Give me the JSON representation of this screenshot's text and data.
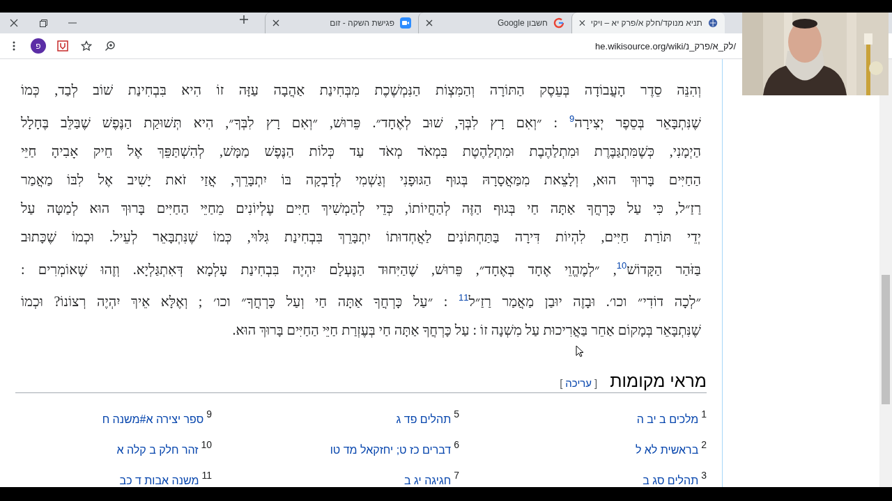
{
  "tabs": [
    {
      "title": "תניא מנוקד/חלק א/פרק יא – ויקי",
      "kind": "globe",
      "selected": true
    },
    {
      "title": "חשבון Google",
      "kind": "letter",
      "selected": false
    },
    {
      "title": "פגישת השקה - זום",
      "kind": "video",
      "selected": false
    }
  ],
  "toolbar": {
    "url": "he.wikisource.org/wiki/לק_א/פרק_נ/",
    "profile_initial": "פ"
  },
  "article": {
    "lines": [
      "וְהִנֵּה סֵדֶר הָעֲבוֹדָה בְּעֵסֶק הַתּוֹרָה וְהַמִּצְוֹת הַנִּמְשֶׁכֶת מִבְּחִינַת אַהֲבָה עַזָּה זוֹ הִיא בִּבְחִינַת שׁוֹב לְבַד, כְּמוֹ",
      "שֶׁנִּתְבָּאֵר בְּסֵפֶר יְצִירָה$^{9}$ : ״וְאִם רָץ לִבְּךָ, שׁוּב לְאֶחָד״. פֵּרוּשׁ, ״וְאִם רָץ לִבְּךָ״, הִיא תְּשׁוּקַת הַנֶּפֶשׁ שֶׁבַּלֵּב בֶּחָלָל",
      "הַיְמָנִי, כְּשֶׁמִּתְגַּבֶּרֶת וּמִתְלַהֶבֶת וּמִתְלַהֶטֶת בִּמְאֹד מְאֹד עַד כְּלוֹת הַנֶּפֶשׁ מַמָּשׁ, לְהִשְׁתַּפֵּךְ אֶל חֵיק אָבִיהָ חַיֵּי",
      "הַחַיִּים בָּרוּךְ הוּא, וְלָצֵאת מִמַּאֲסָרָהּ בְּגוּף הַגּוּפָנִי וְגַשְׁמִי לְדָבְקָה בּוֹ יִתְבָּרֵךְ, אֲזַי זֹאת יָשִׁיב אֶל לִבּוֹ מַאֲמַר",
      "רַזַ״ל, כִּי עַל כָּרְחֲךָ אַתָּה חַי בְּגוּף הַזֶּה לְהַחֲיוֹתוֹ, כְּדֵי לְהַמְשִׁיךְ חַיִּים עֶלְיוֹנִים מֵחַיֵּי הַחַיִּים בָּרוּךְ הוּא לְמַטָּה עַל",
      "יְדֵי תּוֹרַת חַיִּים, לִהְיוֹת דִּירָה בַּתַּחְתּוֹנִים לַאֲחְדוּתוֹ יִתְבָּרֵךְ בִּבְחִינַת גִּלּוּי, כְּמוֹ שֶׁנִּתְבָּאֵר לְעֵיל. וּכְמוֹ שֶׁכָּתוּב",
      "בַּזֹּהַר הַקָּדוֹשׁ$^{10}$, ״לְמֶהֱוֵי אֶחָד בְּאֶחָד״, פֵּרוּשׁ, שֶׁהַיִּחוּד הַנֶּעְלָם יִהְיֶה בִּבְחִינַת עָלְמָא דְּאִתְגַּלְיָא. וְזֶהוּ שֶׁאוֹמְרִים :",
      "״לְכָה דוֹדִי״ וכו׳. וּבָזֶה יוּבַן מַאֲמַר רַזַ״ל$^{11}$ : ״עַל כָּרְחֲךָ אַתָּה חַי וְעַל כָּרְחֲךָ״ וכו׳ ; וְאֶלָּא אֵיךְ יִהְיֶה רְצוֹנוֹ? וּכְמוֹ",
      "שֶׁנִּתְבָּאֵר בְּמָקוֹם אַחֵר בַּאֲרִיכוּת עַל מִשְׁנָה זוֹ : עַל כָּרְחֲךָ אַתָּה חַי בְּעֶזְרַת חַיֵּי הַחַיִּים בָּרוּךְ הוּא."
    ],
    "heading": "מראי מקומות",
    "edit_open": "[",
    "edit_link": "עריכה",
    "edit_close": "]"
  },
  "references": [
    [
      {
        "number": "1",
        "text": "מלכים ב יב ה"
      },
      {
        "number": "2",
        "text": "בראשית לא ל"
      },
      {
        "number": "3",
        "text": "תהלים סג ב"
      }
    ],
    [
      {
        "number": "5",
        "text": "תהלים פד ג"
      },
      {
        "number": "6",
        "text": "דברים כז ט; יחזקאל מד טו"
      },
      {
        "number": "7",
        "text": "חגיגה יג ב"
      }
    ],
    [
      {
        "number": "9",
        "text": "ספר יצירה א#משנה ח"
      },
      {
        "number": "10",
        "text": "זהר חלק ב קלה א"
      },
      {
        "number": "11",
        "text": "משנה אבות ד כב"
      }
    ]
  ]
}
